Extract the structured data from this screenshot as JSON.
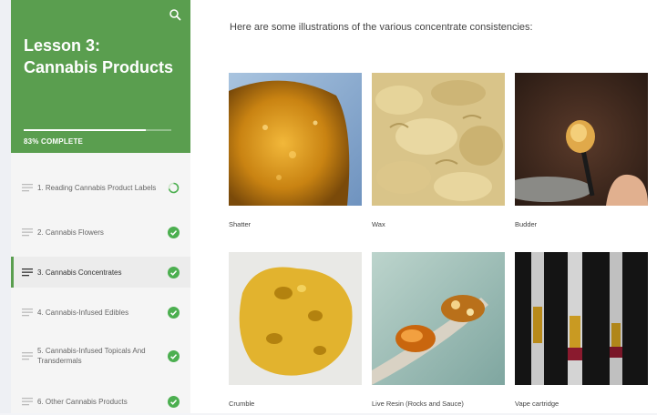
{
  "sidebar": {
    "lesson_title": "Lesson 3: Cannabis Products",
    "progress_text": "83% COMPLETE",
    "progress_fraction": 0.83,
    "topics": [
      {
        "label": "1. Reading Cannabis Product Labels",
        "status": "in-progress"
      },
      {
        "label": "2. Cannabis Flowers",
        "status": "complete"
      },
      {
        "label": "3. Cannabis Concentrates",
        "status": "complete",
        "active": true
      },
      {
        "label": "4. Cannabis-Infused Edibles",
        "status": "complete"
      },
      {
        "label": "5. Cannabis-Infused Topicals And Transdermals",
        "status": "complete"
      },
      {
        "label": "6. Other Cannabis Products",
        "status": "complete"
      }
    ]
  },
  "main": {
    "intro": "Here are some illustrations of the various concentrate consistencies:",
    "images": [
      {
        "caption": "Shatter"
      },
      {
        "caption": "Wax"
      },
      {
        "caption": "Budder"
      },
      {
        "caption": "Crumble"
      },
      {
        "caption": "Live Resin (Rocks and Sauce)"
      },
      {
        "caption": "Vape cartridge"
      }
    ]
  },
  "colors": {
    "accent": "#5a9e4f",
    "complete": "#4caf50"
  },
  "icons": {
    "search": "search-icon",
    "topic": "lines-icon",
    "complete": "check-circle-icon",
    "in_progress": "progress-ring-icon"
  }
}
